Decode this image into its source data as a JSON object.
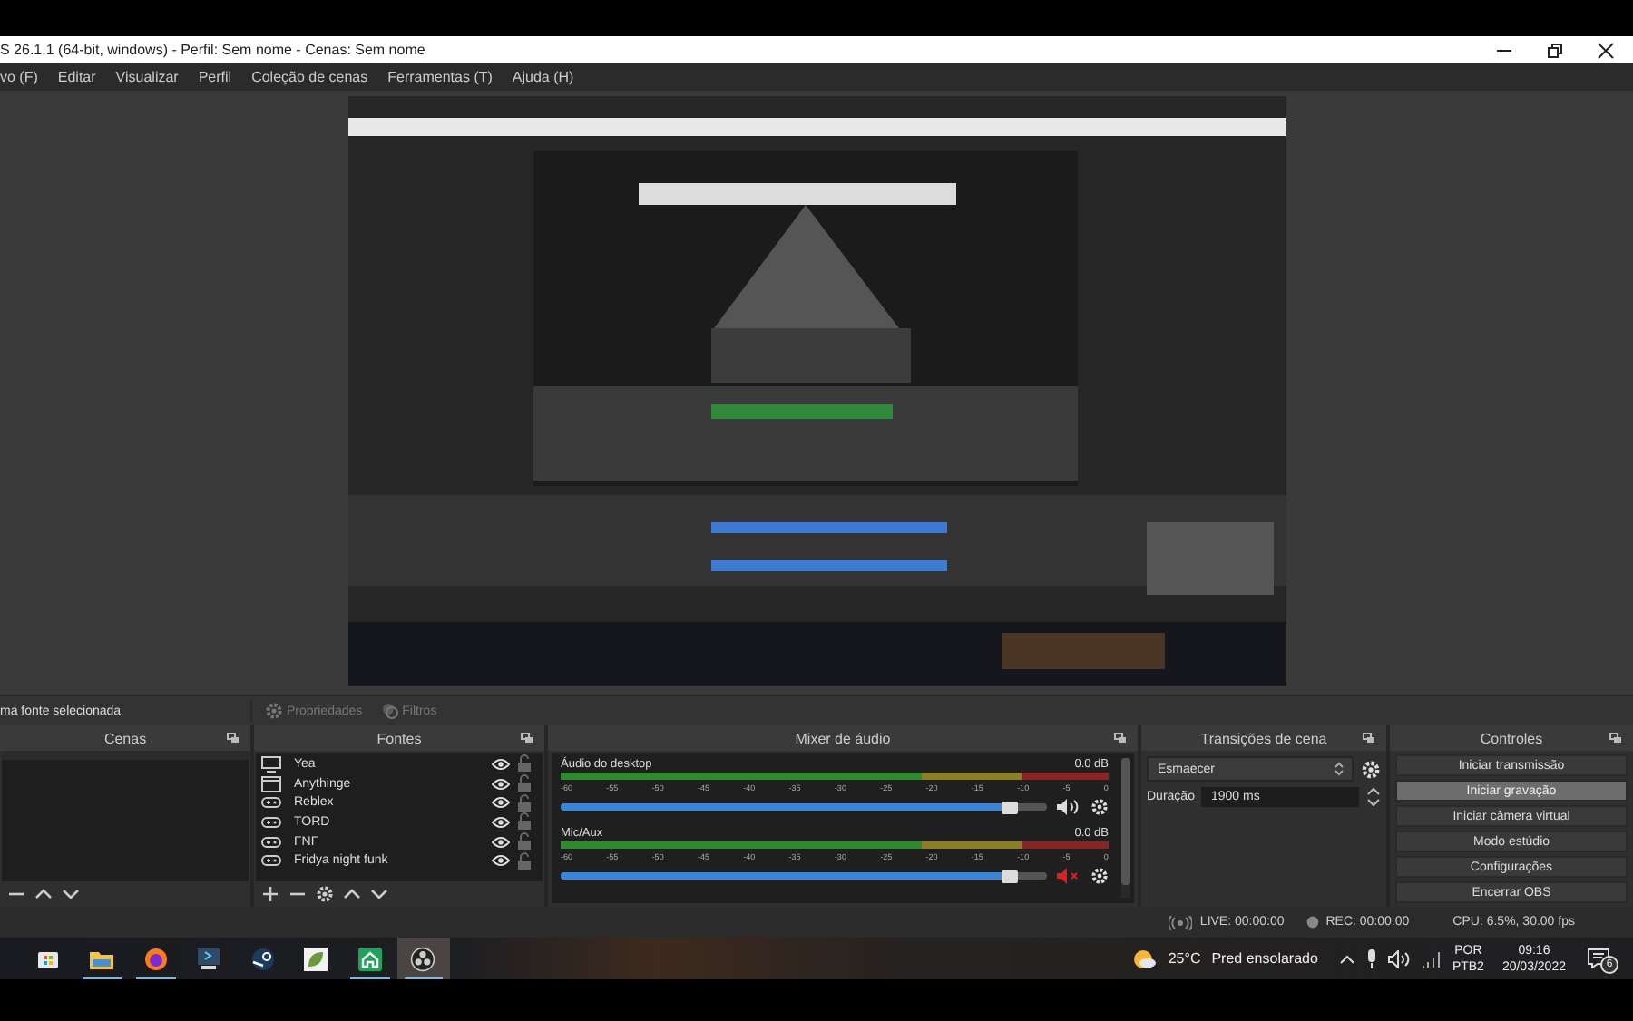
{
  "window": {
    "title": "S 26.1.1 (64-bit, windows) - Perfil: Sem nome - Cenas: Sem nome"
  },
  "menu": [
    "vo (F)",
    "Editar",
    "Visualizar",
    "Perfil",
    "Coleção de cenas",
    "Ferramentas (T)",
    "Ajuda (H)"
  ],
  "preview": {
    "kind": "picture"
  },
  "context_bar": {
    "message": "ma fonte selecionada",
    "buttons": [
      {
        "label": "Propriedades",
        "kind": "gear",
        "disabled": true
      },
      {
        "label": "Filtros",
        "kind": "filter",
        "disabled": true
      }
    ]
  },
  "scenes": {
    "title": "Cenas"
  },
  "sources": {
    "title": "Fontes",
    "items": [
      {
        "name": "Yea",
        "kind": "monitor",
        "visible": true,
        "locked": false
      },
      {
        "name": "Anythinge",
        "kind": "window",
        "visible": true,
        "locked": false
      },
      {
        "name": "Reblex",
        "kind": "game",
        "visible": true,
        "locked": false
      },
      {
        "name": "TORD",
        "kind": "game",
        "visible": true,
        "locked": false
      },
      {
        "name": "FNF",
        "kind": "game",
        "visible": true,
        "locked": false
      },
      {
        "name": "Fridya night funk",
        "kind": "game",
        "visible": true,
        "locked": false
      }
    ]
  },
  "mixer": {
    "title": "Mixer de áudio",
    "channels": [
      {
        "name": "Áudio do desktop",
        "reading": "0.0 dB",
        "level": 0.94,
        "muted": false,
        "ticks": [
          "-60",
          "-55",
          "-50",
          "-45",
          "-40",
          "-35",
          "-30",
          "-25",
          "-20",
          "-15",
          "-10",
          "-5",
          "0"
        ]
      },
      {
        "name": "Mic/Aux",
        "reading": "0.0 dB",
        "level": 0.94,
        "muted": true,
        "ticks": [
          "-60",
          "-55",
          "-50",
          "-45",
          "-40",
          "-35",
          "-30",
          "-25",
          "-20",
          "-15",
          "-10",
          "-5",
          "0"
        ]
      }
    ]
  },
  "transitions": {
    "title": "Transições de cena",
    "transition": "Esmaecer",
    "duration_label": "Duração",
    "duration": "1900 ms"
  },
  "controls": {
    "title": "Controles",
    "buttons": [
      {
        "label": "Iniciar transmissão",
        "hovered": false
      },
      {
        "label": "Iniciar gravação",
        "hovered": true
      },
      {
        "label": "Iniciar câmera virtual",
        "hovered": false
      },
      {
        "label": "Modo estúdio",
        "hovered": false
      },
      {
        "label": "Configurações",
        "hovered": false
      },
      {
        "label": "Encerrar OBS",
        "hovered": false
      }
    ]
  },
  "status_bar": {
    "live": "LIVE: 00:00:00",
    "rec": "REC: 00:00:00",
    "cpu": "CPU: 6.5%, 30.00 fps"
  },
  "taskbar": {
    "apps": [
      {
        "kind": "store",
        "running": false,
        "active": false
      },
      {
        "kind": "folder",
        "running": true,
        "active": false
      },
      {
        "kind": "browser",
        "running": true,
        "active": false
      },
      {
        "kind": "terminal",
        "running": false,
        "active": false
      },
      {
        "kind": "steam",
        "running": false,
        "active": false
      },
      {
        "kind": "leaf",
        "running": false,
        "active": false
      },
      {
        "kind": "house",
        "running": true,
        "active": false
      },
      {
        "kind": "obs",
        "running": true,
        "active": true
      }
    ],
    "weather": {
      "temp": "25°C",
      "text": "Pred ensolarado"
    },
    "language": [
      "POR",
      "PTB2"
    ],
    "time": "09:16",
    "date": "20/03/2022",
    "notifications": "6"
  }
}
